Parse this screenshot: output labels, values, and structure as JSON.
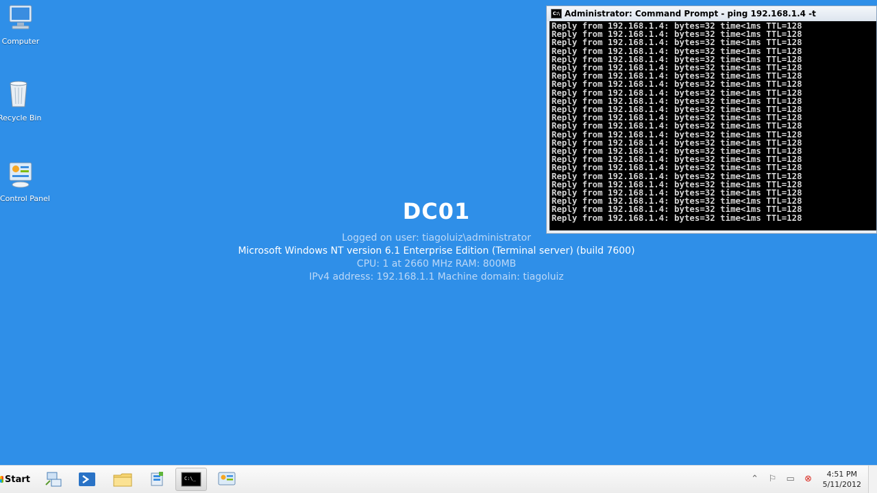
{
  "desktop": {
    "icons": [
      {
        "label": "Computer"
      },
      {
        "label": "Recycle Bin"
      },
      {
        "label": "Control Panel"
      }
    ]
  },
  "bginfo": {
    "hostname": "DC01",
    "logged_on": "Logged on user:  tiagoluiz\\administrator",
    "os": "Microsoft Windows NT version 6.1 Enterprise Edition (Terminal server)  (build 7600)",
    "hardware": "CPU:  1 at 2660 MHz     RAM:  800MB",
    "network": "IPv4 address:  192.168.1.1       Machine domain:  tiagoluiz"
  },
  "cmd_window": {
    "title": "Administrator: Command Prompt - ping  192.168.1.4 -t",
    "lines": [
      "Reply from 192.168.1.4: bytes=32 time<1ms TTL=128",
      "Reply from 192.168.1.4: bytes=32 time<1ms TTL=128",
      "Reply from 192.168.1.4: bytes=32 time<1ms TTL=128",
      "Reply from 192.168.1.4: bytes=32 time<1ms TTL=128",
      "Reply from 192.168.1.4: bytes=32 time<1ms TTL=128",
      "Reply from 192.168.1.4: bytes=32 time<1ms TTL=128",
      "Reply from 192.168.1.4: bytes=32 time<1ms TTL=128",
      "Reply from 192.168.1.4: bytes=32 time<1ms TTL=128",
      "Reply from 192.168.1.4: bytes=32 time<1ms TTL=128",
      "Reply from 192.168.1.4: bytes=32 time<1ms TTL=128",
      "Reply from 192.168.1.4: bytes=32 time<1ms TTL=128",
      "Reply from 192.168.1.4: bytes=32 time<1ms TTL=128",
      "Reply from 192.168.1.4: bytes=32 time<1ms TTL=128",
      "Reply from 192.168.1.4: bytes=32 time<1ms TTL=128",
      "Reply from 192.168.1.4: bytes=32 time<1ms TTL=128",
      "Reply from 192.168.1.4: bytes=32 time<1ms TTL=128",
      "Reply from 192.168.1.4: bytes=32 time<1ms TTL=128",
      "Reply from 192.168.1.4: bytes=32 time<1ms TTL=128",
      "Reply from 192.168.1.4: bytes=32 time<1ms TTL=128",
      "Reply from 192.168.1.4: bytes=32 time<1ms TTL=128",
      "Reply from 192.168.1.4: bytes=32 time<1ms TTL=128",
      "Reply from 192.168.1.4: bytes=32 time<1ms TTL=128",
      "Reply from 192.168.1.4: bytes=32 time<1ms TTL=128",
      "Reply from 192.168.1.4: bytes=32 time<1ms TTL=128"
    ]
  },
  "taskbar": {
    "start_label": "Start",
    "pinned": [
      {
        "icon": "network-icon"
      },
      {
        "icon": "powershell-icon"
      },
      {
        "icon": "explorer-icon"
      },
      {
        "icon": "server-manager-icon"
      },
      {
        "icon": "cmd-icon"
      },
      {
        "icon": "control-panel-icon"
      }
    ],
    "clock_time": "4:51 PM",
    "clock_date": "5/11/2012"
  },
  "colors": {
    "desktop_bg": "#2f8fe8",
    "console_bg": "#000000",
    "console_text": "#d6d6d6"
  }
}
